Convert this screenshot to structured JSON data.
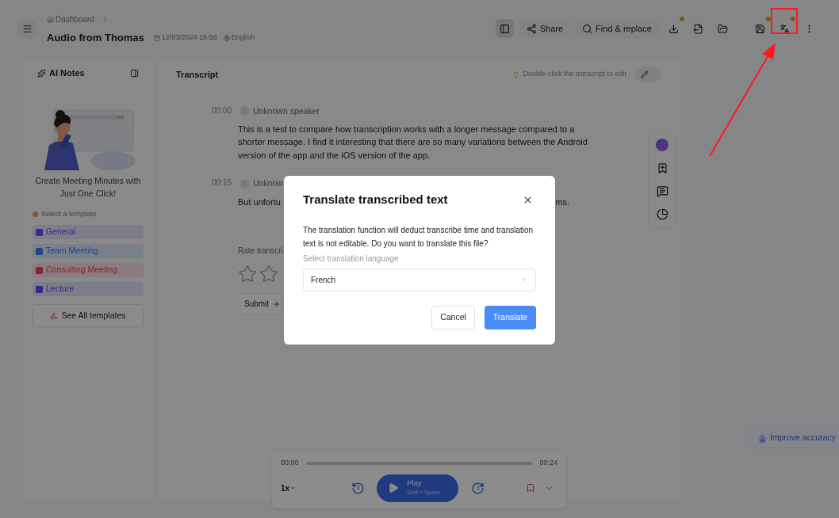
{
  "header": {
    "breadcrumb": "Dashboard",
    "title": "Audio from Thomas",
    "date": "12/03/2024 16:58",
    "language": "English"
  },
  "toolbar": [
    {
      "kind": "toggle",
      "selected": true,
      "badge": false,
      "highlighted": false
    },
    {
      "kind": "share",
      "label": "Share",
      "selected": false,
      "badge": false,
      "highlighted": false
    },
    {
      "kind": "find",
      "label": "Find & replace",
      "selected": false,
      "badge": false,
      "highlighted": false
    },
    {
      "kind": "download",
      "selected": false,
      "badge": true,
      "highlighted": false
    },
    {
      "kind": "export",
      "selected": false,
      "badge": false,
      "highlighted": false
    },
    {
      "kind": "folder",
      "selected": false,
      "badge": false,
      "highlighted": false
    },
    {
      "kind": "save",
      "selected": false,
      "badge": true,
      "highlighted": false
    },
    {
      "kind": "translate",
      "selected": false,
      "badge": true,
      "highlighted": true
    },
    {
      "kind": "more",
      "selected": false,
      "badge": false,
      "highlighted": false
    }
  ],
  "ai_notes": {
    "title": "AI Notes",
    "promo": "Create Meeting Minutes with Just One Click!",
    "template_hint": "Select a template",
    "templates": [
      {
        "label": "General",
        "color": "#3a2a8a"
      },
      {
        "label": "Team Meeting",
        "color": "#1e4690"
      },
      {
        "label": "Consulting Meeting",
        "color": "#8a2040"
      },
      {
        "label": "Lecture",
        "color": "#33288a"
      }
    ],
    "see_all": "See All templates"
  },
  "transcript": {
    "title": "Transcript",
    "hint": "Double-click the transcript to edit",
    "segments": [
      {
        "time": "00:00",
        "speaker": "Unknown speaker",
        "text": "This is a test to compare how transcription works with a longer message compared to a shorter message. I find it interesting that there are so many variations between the Android version of the app and the iOS version of the app."
      },
      {
        "time": "00:15",
        "speaker": "Unknow",
        "text": "But unfortu",
        "text_end": "ms."
      }
    ],
    "rating": {
      "label": "Rate transcri",
      "submit": "Submit"
    }
  },
  "side_tools": [
    {
      "kind": "ai"
    },
    {
      "kind": "bookmark"
    },
    {
      "kind": "comment"
    },
    {
      "kind": "chart"
    }
  ],
  "improve_accuracy": "Improve accuracy",
  "player": {
    "start": "00:00",
    "end": "00:24",
    "level": 0,
    "speed": "1x",
    "rewind": "3",
    "forward": "3",
    "play": "Play",
    "shortcut": "Shift + Space"
  },
  "dialog": {
    "title": "Translate transcribed text",
    "body": "The translation function will deduct transcribe time and translation text is not editable. Do you want to translate this file?",
    "field_label": "Select translation language",
    "value": "French",
    "cancel": "Cancel",
    "confirm": "Translate"
  }
}
